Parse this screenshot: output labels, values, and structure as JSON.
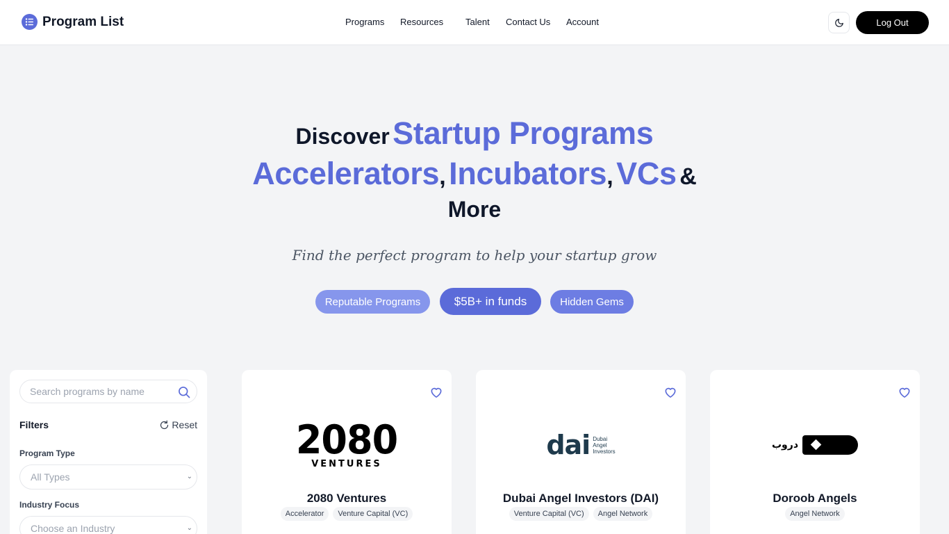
{
  "header": {
    "brand": "Program List",
    "nav": [
      "Programs",
      "Resources",
      "Talent",
      "Contact Us",
      "Account"
    ],
    "logout_label": "Log Out"
  },
  "hero": {
    "line1_prefix": "Discover",
    "line1_accent": "Startup Programs",
    "line2_accent1": "Accelerators",
    "line2_sep1": ",",
    "line2_accent2": "Incubators",
    "line2_sep2": ",",
    "line2_accent3": "VCs",
    "line2_suffix": "&",
    "line3": "More",
    "tagline": "Find the perfect program to help your startup grow",
    "pills": [
      "Reputable Programs",
      "$5B+ in funds",
      "Hidden Gems"
    ]
  },
  "sidebar": {
    "search_placeholder": "Search programs by name",
    "filters_label": "Filters",
    "reset_label": "Reset",
    "program_type_label": "Program Type",
    "program_type_value": "All Types",
    "industry_label": "Industry Focus",
    "industry_value": "Choose an Industry"
  },
  "programs": [
    {
      "name": "2080 Ventures",
      "tags": [
        "Accelerator",
        "Venture Capital (VC)"
      ],
      "logo_text": "2080",
      "logo_sub": "VENTURES"
    },
    {
      "name": "Dubai Angel Investors (DAI)",
      "tags": [
        "Venture Capital (VC)",
        "Angel Network"
      ],
      "logo_text": "dai",
      "logo_sub": [
        "Dubai",
        "Angel",
        "Investors"
      ]
    },
    {
      "name": "Doroob Angels",
      "tags": [
        "Angel Network"
      ],
      "logo_text": "دروب"
    }
  ],
  "colors": {
    "accent": "#5b6bd9",
    "background": "#f3f4f6",
    "dark": "#0f172a"
  }
}
